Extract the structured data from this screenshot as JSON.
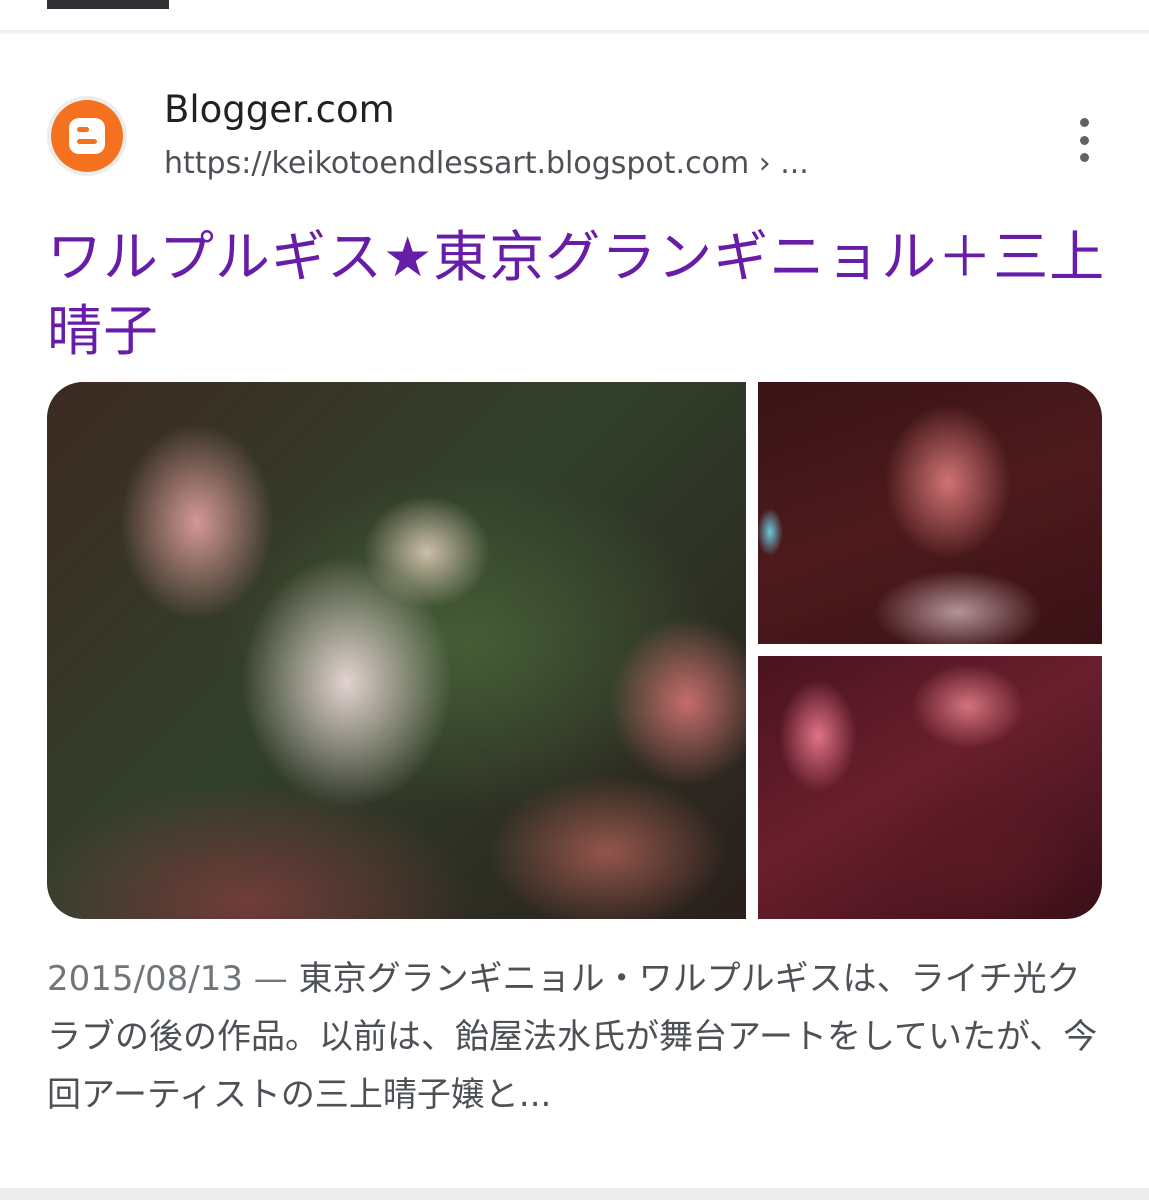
{
  "result": {
    "site_name": "Blogger.com",
    "site_url": "https://keikotoendlessart.blogspot.com › ...",
    "site_icon": "blogger-logo-icon",
    "more_icon": "more-vert-icon",
    "title": "ワルプルギス★東京グランギニョル＋三上晴子",
    "date": "2015/08/13",
    "separator": " — ",
    "snippet": "東京グランギニョル・ワルプルギスは、ライチ光クラブの後の作品。以前は、飴屋法水氏が舞台アートをしていたが、今回アーティストの三上晴子嬢と..."
  },
  "colors": {
    "title_visited": "#681da8",
    "blogger_orange": "#f5701f",
    "snippet_text": "#4d5156"
  }
}
